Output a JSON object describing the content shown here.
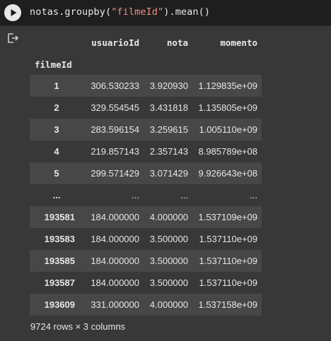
{
  "code": {
    "prefix": "notas.groupby(",
    "string": "\"filmeId\"",
    "suffix": ").mean()"
  },
  "table": {
    "columns": [
      "usuarioId",
      "nota",
      "momento"
    ],
    "index_name": "filmeId",
    "rows": [
      {
        "index": "1",
        "usuarioId": "306.530233",
        "nota": "3.920930",
        "momento": "1.129835e+09"
      },
      {
        "index": "2",
        "usuarioId": "329.554545",
        "nota": "3.431818",
        "momento": "1.135805e+09"
      },
      {
        "index": "3",
        "usuarioId": "283.596154",
        "nota": "3.259615",
        "momento": "1.005110e+09"
      },
      {
        "index": "4",
        "usuarioId": "219.857143",
        "nota": "2.357143",
        "momento": "8.985789e+08"
      },
      {
        "index": "5",
        "usuarioId": "299.571429",
        "nota": "3.071429",
        "momento": "9.926643e+08"
      },
      {
        "index": "...",
        "usuarioId": "...",
        "nota": "...",
        "momento": "..."
      },
      {
        "index": "193581",
        "usuarioId": "184.000000",
        "nota": "4.000000",
        "momento": "1.537109e+09"
      },
      {
        "index": "193583",
        "usuarioId": "184.000000",
        "nota": "3.500000",
        "momento": "1.537110e+09"
      },
      {
        "index": "193585",
        "usuarioId": "184.000000",
        "nota": "3.500000",
        "momento": "1.537110e+09"
      },
      {
        "index": "193587",
        "usuarioId": "184.000000",
        "nota": "3.500000",
        "momento": "1.537110e+09"
      },
      {
        "index": "193609",
        "usuarioId": "331.000000",
        "nota": "4.000000",
        "momento": "1.537158e+09"
      }
    ]
  },
  "shape_text": "9724 rows × 3 columns",
  "icons": {
    "run": "play-icon",
    "output": "output-redirect-icon"
  },
  "colors": {
    "cell_background": "#1e1e1e",
    "output_background": "#383838",
    "stripe": "#474747",
    "string_literal": "#f28b82"
  }
}
